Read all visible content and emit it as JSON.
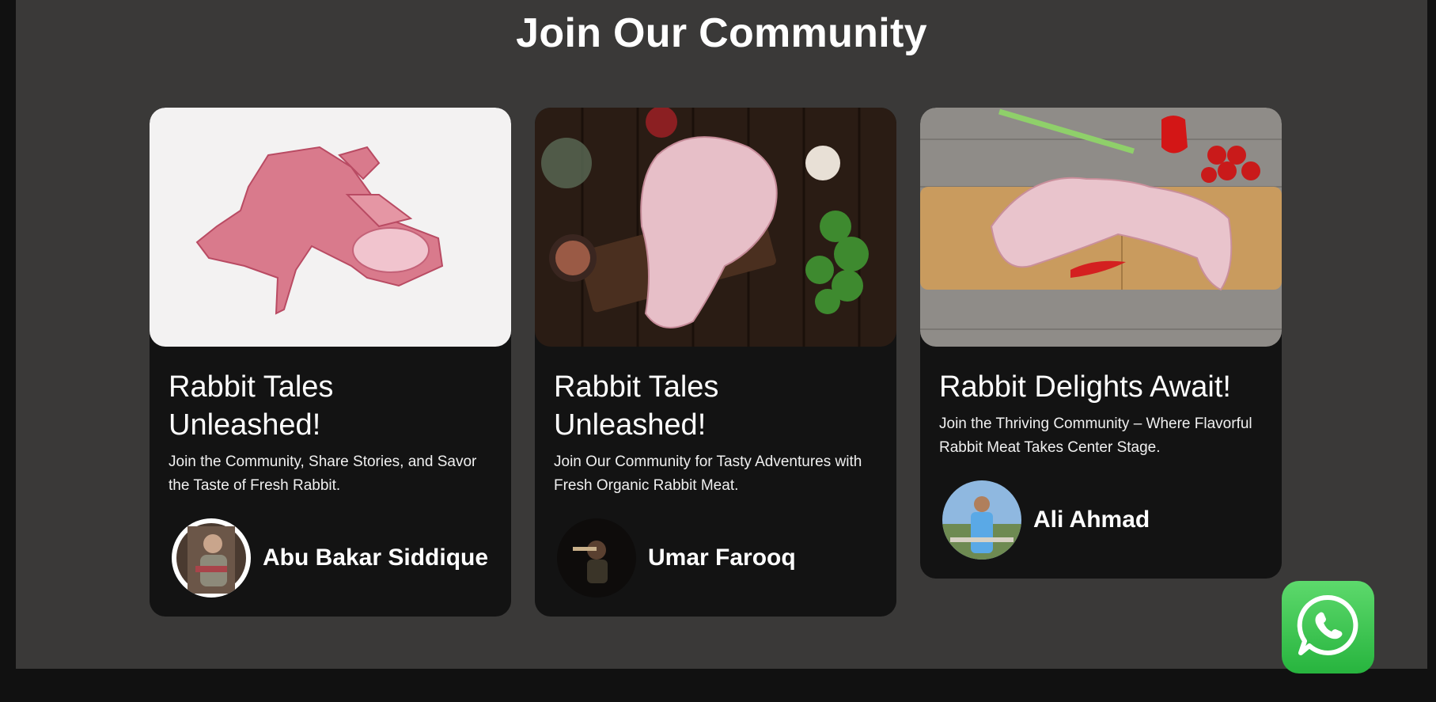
{
  "section": {
    "title": "Join Our Community"
  },
  "cards": [
    {
      "heading": "Rabbit Tales Unleashed!",
      "text": "Join the Community, Share Stories, and Savor the Taste of Fresh Rabbit.",
      "author": "Abu Bakar Siddique"
    },
    {
      "heading": "Rabbit Tales Unleashed!",
      "text": "Join Our Community for Tasty Adventures with Fresh Organic Rabbit Meat.",
      "author": "Umar Farooq"
    },
    {
      "heading": "Rabbit Delights Await!",
      "text": "Join the Thriving Community – Where Flavorful Rabbit Meat Takes Center Stage.",
      "author": "Ali Ahmad"
    }
  ],
  "floating": {
    "icon": "whatsapp-icon"
  },
  "colors": {
    "section_bg": "#3a3938",
    "card_bg": "#131313",
    "page_bg": "#111111",
    "whatsapp_green": "#2fbe45"
  }
}
